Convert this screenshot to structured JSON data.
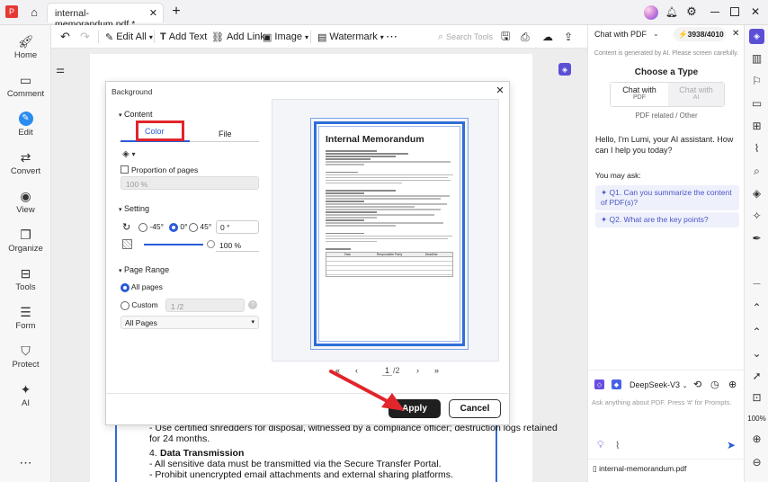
{
  "window": {
    "tab_title": "internal-memorandum.pdf *",
    "new_tab_symbol": "+"
  },
  "left_rail": [
    {
      "label": "Home",
      "icon": "rocket-icon"
    },
    {
      "label": "Comment",
      "icon": "comment-icon"
    },
    {
      "label": "Edit",
      "icon": "edit-icon"
    },
    {
      "label": "Convert",
      "icon": "convert-icon"
    },
    {
      "label": "View",
      "icon": "eye-icon"
    },
    {
      "label": "Organize",
      "icon": "organize-icon"
    },
    {
      "label": "Tools",
      "icon": "toolbox-icon"
    },
    {
      "label": "Form",
      "icon": "form-icon"
    },
    {
      "label": "Protect",
      "icon": "shield-icon"
    },
    {
      "label": "AI",
      "icon": "ai-icon"
    }
  ],
  "toolbar": {
    "edit_all": "Edit All",
    "add_text": "Add Text",
    "add_link": "Add Link",
    "image": "Image",
    "watermark": "Watermark",
    "search_placeholder": "Search Tools"
  },
  "dialog": {
    "title": "Background",
    "content_heading": "Content",
    "tab_color": "Color",
    "tab_file": "File",
    "proportion_label": "Proportion of pages",
    "proportion_value": "100 %",
    "setting_heading": "Setting",
    "rot_neg45": "-45°",
    "rot_0": "0°",
    "rot_45": "45°",
    "rot_value": "0 °",
    "opacity_value": "100 %",
    "page_range_heading": "Page Range",
    "all_pages": "All pages",
    "custom": "Custom",
    "custom_placeholder": "1 /2",
    "pages_select": "All Pages",
    "page_indicator": "1",
    "page_total": "/2",
    "apply": "Apply",
    "cancel": "Cancel"
  },
  "preview": {
    "heading": "Internal Memorandum",
    "table_header": [
      "Task",
      "Responsible Party",
      "Deadline"
    ]
  },
  "doc_bottom": {
    "line1": "- Use certified shredders for disposal, witnessed by a compliance officer; destruction logs retained",
    "line2": "for 24 months.",
    "item_num": "4.",
    "item_title": "Data Transmission",
    "line3": "- All sensitive data must be transmitted via the Secure Transfer Portal.",
    "line4": "- Prohibit unencrypted email attachments and external sharing platforms."
  },
  "chat": {
    "header_title": "Chat with PDF",
    "credits": "3938/4010",
    "disclaimer": "Content is generated by AI. Please screen carefully.",
    "choose_type": "Choose a Type",
    "opt1_line1": "Chat with",
    "opt1_line2": "PDF",
    "opt2_line1": "Chat with",
    "opt2_line2": "AI",
    "related": "PDF related / Other",
    "greeting": "Hello, I'm Lumi, your AI assistant. How can I help you today?",
    "you_may_ask": "You may ask:",
    "q1": "Q1. Can you summarize the content of PDF(s)?",
    "q2": "Q2. What are the key points?",
    "model": "DeepSeek-V3",
    "input_placeholder": "Ask anything about PDF. Press '#' for Prompts.",
    "file_name": "internal-memorandum.pdf"
  },
  "right_rail": {
    "zoom": "100%"
  },
  "colors": {
    "accent": "#2a5bd7",
    "highlight_red": "#e0262b",
    "apply_bg": "#1f1f1f"
  }
}
